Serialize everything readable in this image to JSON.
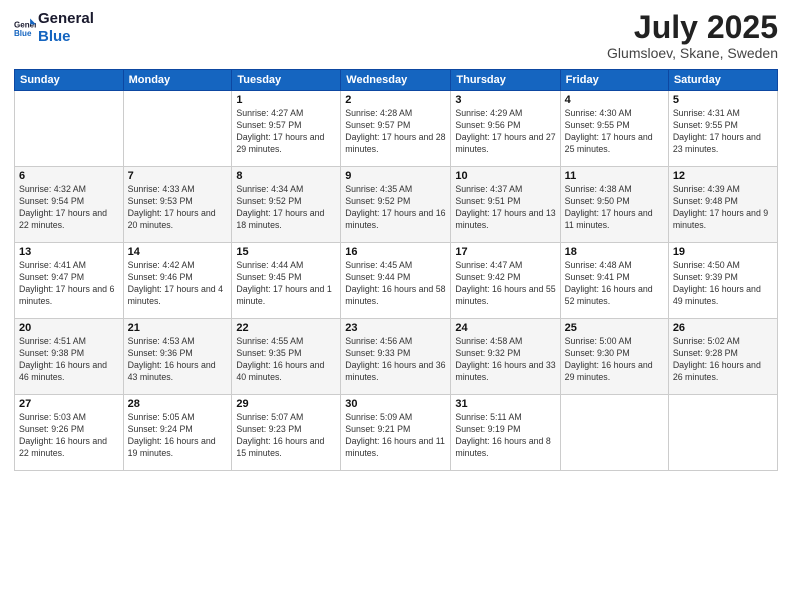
{
  "header": {
    "logo_general": "General",
    "logo_blue": "Blue",
    "main_title": "July 2025",
    "subtitle": "Glumsloev, Skane, Sweden"
  },
  "days_of_week": [
    "Sunday",
    "Monday",
    "Tuesday",
    "Wednesday",
    "Thursday",
    "Friday",
    "Saturday"
  ],
  "weeks": [
    [
      {
        "day": "",
        "sunrise": "",
        "sunset": "",
        "daylight": ""
      },
      {
        "day": "",
        "sunrise": "",
        "sunset": "",
        "daylight": ""
      },
      {
        "day": "1",
        "sunrise": "Sunrise: 4:27 AM",
        "sunset": "Sunset: 9:57 PM",
        "daylight": "Daylight: 17 hours and 29 minutes."
      },
      {
        "day": "2",
        "sunrise": "Sunrise: 4:28 AM",
        "sunset": "Sunset: 9:57 PM",
        "daylight": "Daylight: 17 hours and 28 minutes."
      },
      {
        "day": "3",
        "sunrise": "Sunrise: 4:29 AM",
        "sunset": "Sunset: 9:56 PM",
        "daylight": "Daylight: 17 hours and 27 minutes."
      },
      {
        "day": "4",
        "sunrise": "Sunrise: 4:30 AM",
        "sunset": "Sunset: 9:55 PM",
        "daylight": "Daylight: 17 hours and 25 minutes."
      },
      {
        "day": "5",
        "sunrise": "Sunrise: 4:31 AM",
        "sunset": "Sunset: 9:55 PM",
        "daylight": "Daylight: 17 hours and 23 minutes."
      }
    ],
    [
      {
        "day": "6",
        "sunrise": "Sunrise: 4:32 AM",
        "sunset": "Sunset: 9:54 PM",
        "daylight": "Daylight: 17 hours and 22 minutes."
      },
      {
        "day": "7",
        "sunrise": "Sunrise: 4:33 AM",
        "sunset": "Sunset: 9:53 PM",
        "daylight": "Daylight: 17 hours and 20 minutes."
      },
      {
        "day": "8",
        "sunrise": "Sunrise: 4:34 AM",
        "sunset": "Sunset: 9:52 PM",
        "daylight": "Daylight: 17 hours and 18 minutes."
      },
      {
        "day": "9",
        "sunrise": "Sunrise: 4:35 AM",
        "sunset": "Sunset: 9:52 PM",
        "daylight": "Daylight: 17 hours and 16 minutes."
      },
      {
        "day": "10",
        "sunrise": "Sunrise: 4:37 AM",
        "sunset": "Sunset: 9:51 PM",
        "daylight": "Daylight: 17 hours and 13 minutes."
      },
      {
        "day": "11",
        "sunrise": "Sunrise: 4:38 AM",
        "sunset": "Sunset: 9:50 PM",
        "daylight": "Daylight: 17 hours and 11 minutes."
      },
      {
        "day": "12",
        "sunrise": "Sunrise: 4:39 AM",
        "sunset": "Sunset: 9:48 PM",
        "daylight": "Daylight: 17 hours and 9 minutes."
      }
    ],
    [
      {
        "day": "13",
        "sunrise": "Sunrise: 4:41 AM",
        "sunset": "Sunset: 9:47 PM",
        "daylight": "Daylight: 17 hours and 6 minutes."
      },
      {
        "day": "14",
        "sunrise": "Sunrise: 4:42 AM",
        "sunset": "Sunset: 9:46 PM",
        "daylight": "Daylight: 17 hours and 4 minutes."
      },
      {
        "day": "15",
        "sunrise": "Sunrise: 4:44 AM",
        "sunset": "Sunset: 9:45 PM",
        "daylight": "Daylight: 17 hours and 1 minute."
      },
      {
        "day": "16",
        "sunrise": "Sunrise: 4:45 AM",
        "sunset": "Sunset: 9:44 PM",
        "daylight": "Daylight: 16 hours and 58 minutes."
      },
      {
        "day": "17",
        "sunrise": "Sunrise: 4:47 AM",
        "sunset": "Sunset: 9:42 PM",
        "daylight": "Daylight: 16 hours and 55 minutes."
      },
      {
        "day": "18",
        "sunrise": "Sunrise: 4:48 AM",
        "sunset": "Sunset: 9:41 PM",
        "daylight": "Daylight: 16 hours and 52 minutes."
      },
      {
        "day": "19",
        "sunrise": "Sunrise: 4:50 AM",
        "sunset": "Sunset: 9:39 PM",
        "daylight": "Daylight: 16 hours and 49 minutes."
      }
    ],
    [
      {
        "day": "20",
        "sunrise": "Sunrise: 4:51 AM",
        "sunset": "Sunset: 9:38 PM",
        "daylight": "Daylight: 16 hours and 46 minutes."
      },
      {
        "day": "21",
        "sunrise": "Sunrise: 4:53 AM",
        "sunset": "Sunset: 9:36 PM",
        "daylight": "Daylight: 16 hours and 43 minutes."
      },
      {
        "day": "22",
        "sunrise": "Sunrise: 4:55 AM",
        "sunset": "Sunset: 9:35 PM",
        "daylight": "Daylight: 16 hours and 40 minutes."
      },
      {
        "day": "23",
        "sunrise": "Sunrise: 4:56 AM",
        "sunset": "Sunset: 9:33 PM",
        "daylight": "Daylight: 16 hours and 36 minutes."
      },
      {
        "day": "24",
        "sunrise": "Sunrise: 4:58 AM",
        "sunset": "Sunset: 9:32 PM",
        "daylight": "Daylight: 16 hours and 33 minutes."
      },
      {
        "day": "25",
        "sunrise": "Sunrise: 5:00 AM",
        "sunset": "Sunset: 9:30 PM",
        "daylight": "Daylight: 16 hours and 29 minutes."
      },
      {
        "day": "26",
        "sunrise": "Sunrise: 5:02 AM",
        "sunset": "Sunset: 9:28 PM",
        "daylight": "Daylight: 16 hours and 26 minutes."
      }
    ],
    [
      {
        "day": "27",
        "sunrise": "Sunrise: 5:03 AM",
        "sunset": "Sunset: 9:26 PM",
        "daylight": "Daylight: 16 hours and 22 minutes."
      },
      {
        "day": "28",
        "sunrise": "Sunrise: 5:05 AM",
        "sunset": "Sunset: 9:24 PM",
        "daylight": "Daylight: 16 hours and 19 minutes."
      },
      {
        "day": "29",
        "sunrise": "Sunrise: 5:07 AM",
        "sunset": "Sunset: 9:23 PM",
        "daylight": "Daylight: 16 hours and 15 minutes."
      },
      {
        "day": "30",
        "sunrise": "Sunrise: 5:09 AM",
        "sunset": "Sunset: 9:21 PM",
        "daylight": "Daylight: 16 hours and 11 minutes."
      },
      {
        "day": "31",
        "sunrise": "Sunrise: 5:11 AM",
        "sunset": "Sunset: 9:19 PM",
        "daylight": "Daylight: 16 hours and 8 minutes."
      },
      {
        "day": "",
        "sunrise": "",
        "sunset": "",
        "daylight": ""
      },
      {
        "day": "",
        "sunrise": "",
        "sunset": "",
        "daylight": ""
      }
    ]
  ]
}
